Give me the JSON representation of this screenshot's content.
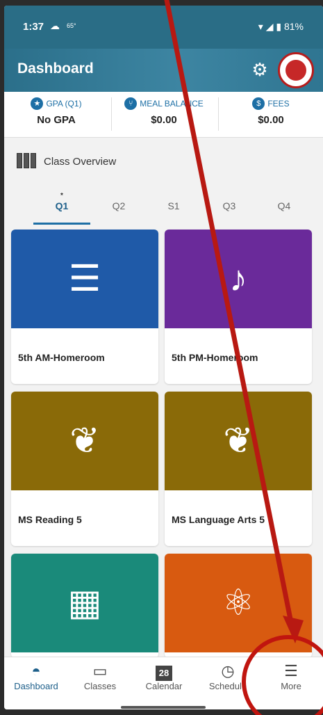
{
  "status_bar": {
    "time": "1:37",
    "temp": "65°",
    "battery": "81%"
  },
  "app_bar": {
    "title": "Dashboard"
  },
  "stats": [
    {
      "label": "GPA (Q1)",
      "value": "No GPA",
      "icon": "star-icon"
    },
    {
      "label": "MEAL BALANCE",
      "value": "$0.00",
      "icon": "utensils-icon"
    },
    {
      "label": "FEES",
      "value": "$0.00",
      "icon": "dollar-icon"
    }
  ],
  "overview": {
    "label": "Class Overview"
  },
  "tabs": [
    {
      "label": "Q1",
      "active": true,
      "marker": "*"
    },
    {
      "label": "Q2"
    },
    {
      "label": "S1"
    },
    {
      "label": "Q3"
    },
    {
      "label": "Q4"
    }
  ],
  "classes": [
    {
      "name": "5th AM-Homeroom",
      "color": "#1f5aa8",
      "icon": "books-icon"
    },
    {
      "name": "5th PM-Homeroom",
      "color": "#6a2a9a",
      "icon": "theater-masks-icon"
    },
    {
      "name": "MS Reading 5",
      "color": "#8a6a08",
      "icon": "reading-icon"
    },
    {
      "name": "MS Language Arts 5",
      "color": "#8a6a08",
      "icon": "reading-icon"
    },
    {
      "name": "",
      "color": "#1a8a7a",
      "icon": "calculator-icon"
    },
    {
      "name": "",
      "color": "#d85a10",
      "icon": "atom-icon"
    }
  ],
  "bottom_nav": [
    {
      "label": "Dashboard",
      "icon": "dashboard-icon",
      "active": true
    },
    {
      "label": "Classes",
      "icon": "classes-icon"
    },
    {
      "label": "Calendar",
      "icon": "calendar-icon",
      "day": "28"
    },
    {
      "label": "Schedule",
      "icon": "schedule-icon"
    },
    {
      "label": "More",
      "icon": "menu-icon"
    }
  ],
  "colors": {
    "primary": "#2a6d86",
    "accent": "#1d6fa5",
    "annotation": "#c0150f"
  }
}
